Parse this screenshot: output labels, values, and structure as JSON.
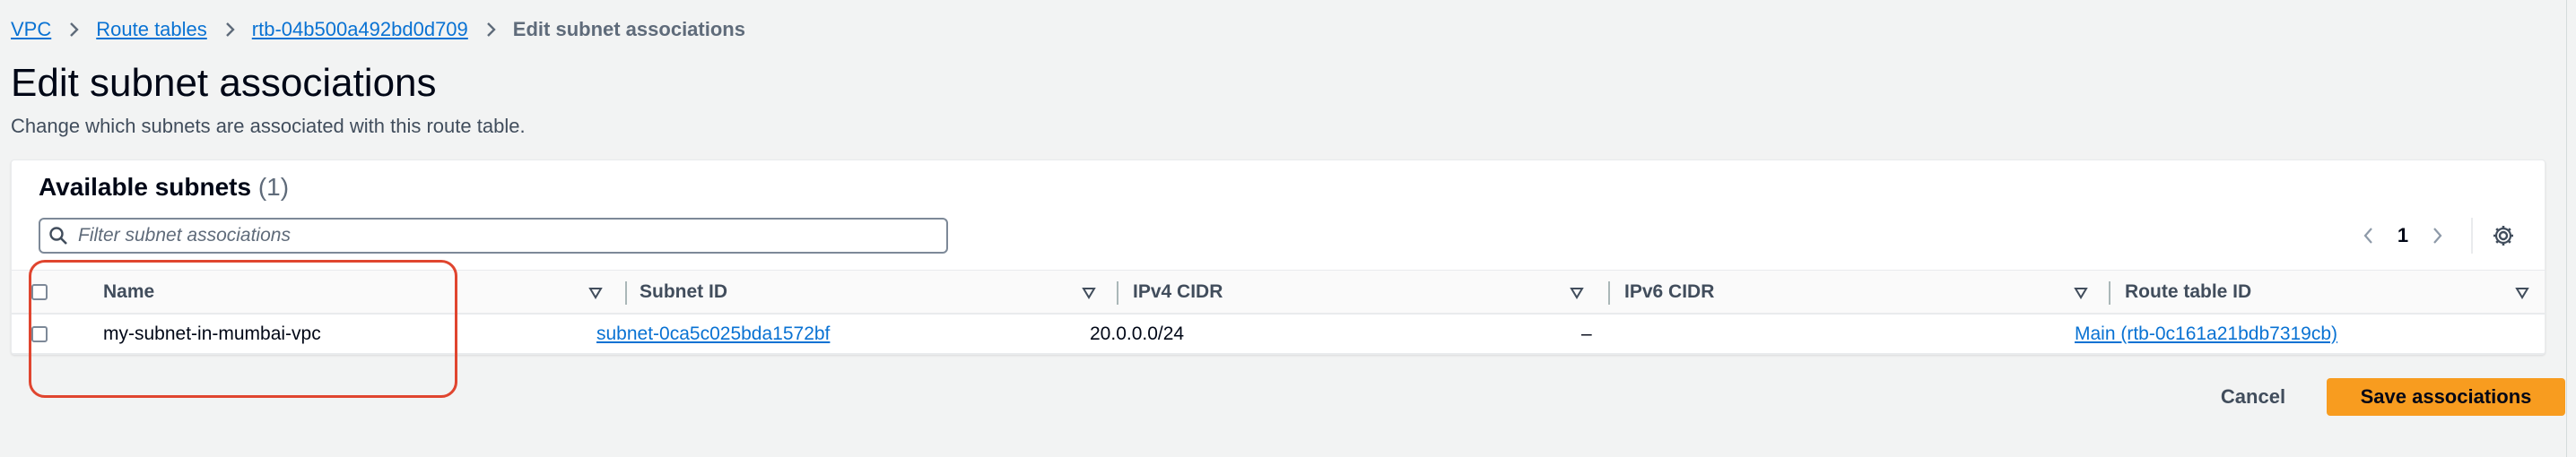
{
  "breadcrumb": {
    "items": [
      "VPC",
      "Route tables",
      "rtb-04b500a492bd0d709"
    ],
    "current": "Edit subnet associations"
  },
  "page": {
    "title": "Edit subnet associations",
    "description": "Change which subnets are associated with this route table."
  },
  "panel": {
    "header": "Available subnets",
    "count": "(1)",
    "filter_placeholder": "Filter subnet associations",
    "filter_value": "",
    "page_number": "1"
  },
  "table": {
    "columns": [
      "Name",
      "Subnet ID",
      "IPv4 CIDR",
      "IPv6 CIDR",
      "Route table ID"
    ],
    "rows": [
      {
        "selected": false,
        "name": "my-subnet-in-mumbai-vpc",
        "subnet_id": "subnet-0ca5c025bda1572bf",
        "ipv4_cidr": "20.0.0.0/24",
        "ipv6_cidr": "–",
        "route_table_id": "Main (rtb-0c161a21bdb7319cb)"
      }
    ]
  },
  "actions": {
    "cancel_label": "Cancel",
    "save_label": "Save associations"
  },
  "icons": {
    "breadcrumb_separator": "chevron-right-icon",
    "search": "search-icon",
    "prev": "chevron-left-icon",
    "next": "chevron-right-icon",
    "settings": "gear-icon",
    "sort": "caret-down-icon"
  },
  "colors": {
    "link": "#0972d3",
    "primary_button": "#f89c1f",
    "annotation": "#e0452f",
    "page_background": "#f2f3f3"
  }
}
